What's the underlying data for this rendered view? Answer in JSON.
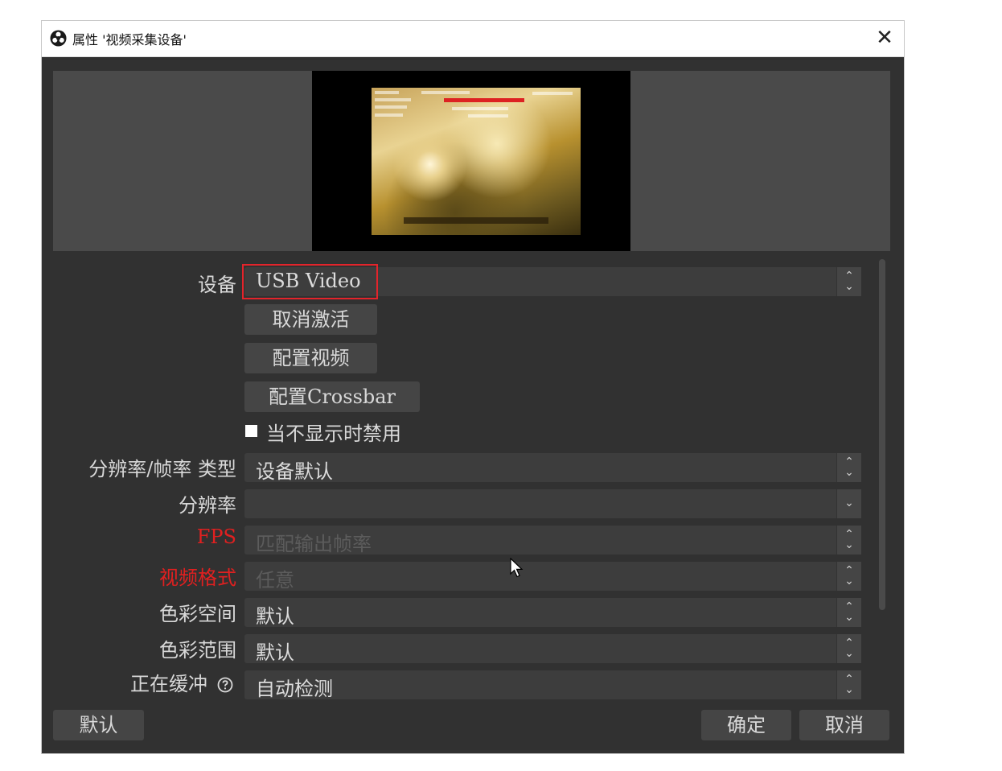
{
  "window": {
    "title": "属性 '视频采集设备'",
    "close_symbol": "✕"
  },
  "form": {
    "device_label": "设备",
    "device_value": "USB Video",
    "deactivate_button": "取消激活",
    "configure_video_button": "配置视频",
    "configure_crossbar_button": "配置Crossbar",
    "disable_when_hidden_label": "当不显示时禁用",
    "disable_when_hidden_checked": false,
    "res_fps_type_label": "分辨率/帧率 类型",
    "res_fps_type_value": "设备默认",
    "resolution_label": "分辨率",
    "resolution_value": "",
    "fps_label": "FPS",
    "fps_value": "匹配输出帧率",
    "video_format_label": "视频格式",
    "video_format_value": "任意",
    "color_space_label": "色彩空间",
    "color_space_value": "默认",
    "color_range_label": "色彩范围",
    "color_range_value": "默认",
    "buffering_label": "正在缓冲",
    "buffering_value": "自动检测"
  },
  "footer": {
    "defaults_button": "默认",
    "ok_button": "确定",
    "cancel_button": "取消"
  },
  "colors": {
    "dialog_background": "#313131",
    "control_background": "#3d3d3d",
    "button_background": "#454545",
    "disabled_label": "#e02020",
    "highlight_box": "#e3242b"
  },
  "icons": {
    "app_logo": "obs-logo-icon",
    "close": "close-icon",
    "help": "help-circle-icon",
    "cursor": "mouse-pointer-icon"
  }
}
